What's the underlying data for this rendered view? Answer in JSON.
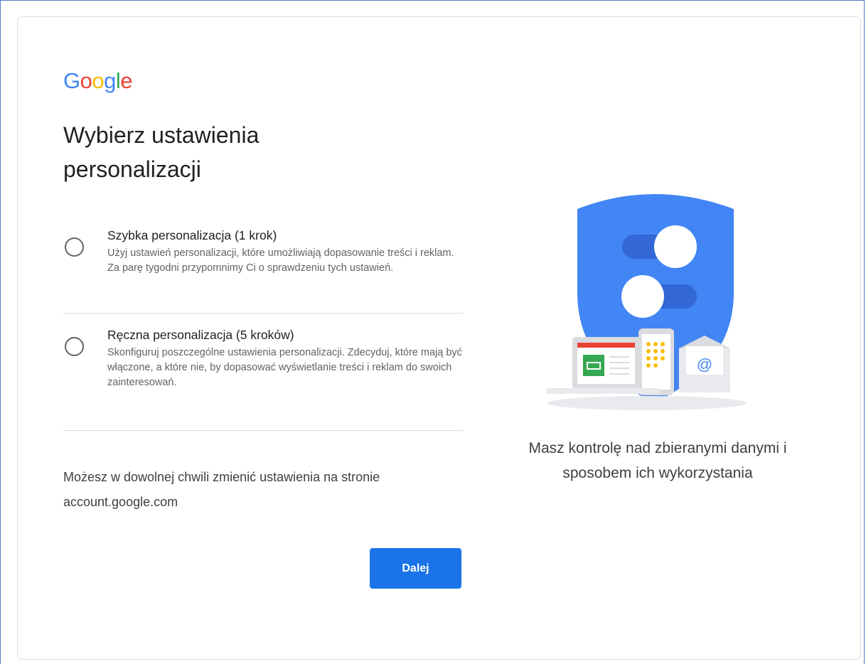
{
  "logo": {
    "letters": [
      "G",
      "o",
      "o",
      "g",
      "l",
      "e"
    ],
    "colors": [
      "#4285F4",
      "#EA4335",
      "#FBBC05",
      "#4285F4",
      "#34A853",
      "#EA4335"
    ]
  },
  "title": "Wybierz ustawienia personalizacji",
  "options": [
    {
      "title": "Szybka personalizacja (1 krok)",
      "description": "Użyj ustawień personalizacji, które umożliwiają dopasowanie treści i reklam. Za parę tygodni przypomnimy Ci o sprawdzeniu tych ustawień.",
      "selected": false
    },
    {
      "title": "Ręczna personalizacja (5 kroków)",
      "description": "Skonfiguruj poszczególne ustawienia personalizacji. Zdecyduj, które mają być włączone, a które nie, by dopasować wyświetlanie treści i reklam do swoich zainteresowań.",
      "selected": false
    }
  ],
  "note": "Możesz w dowolnej chwili zmienić ustawienia na stronie account.google.com",
  "next_button": "Dalej",
  "caption": "Masz kontrolę nad zbieranymi danymi i sposobem ich wykorzystania",
  "colors": {
    "accent": "#1a73e8",
    "shield": "#4285F4",
    "shield_dark": "#3367D6"
  }
}
